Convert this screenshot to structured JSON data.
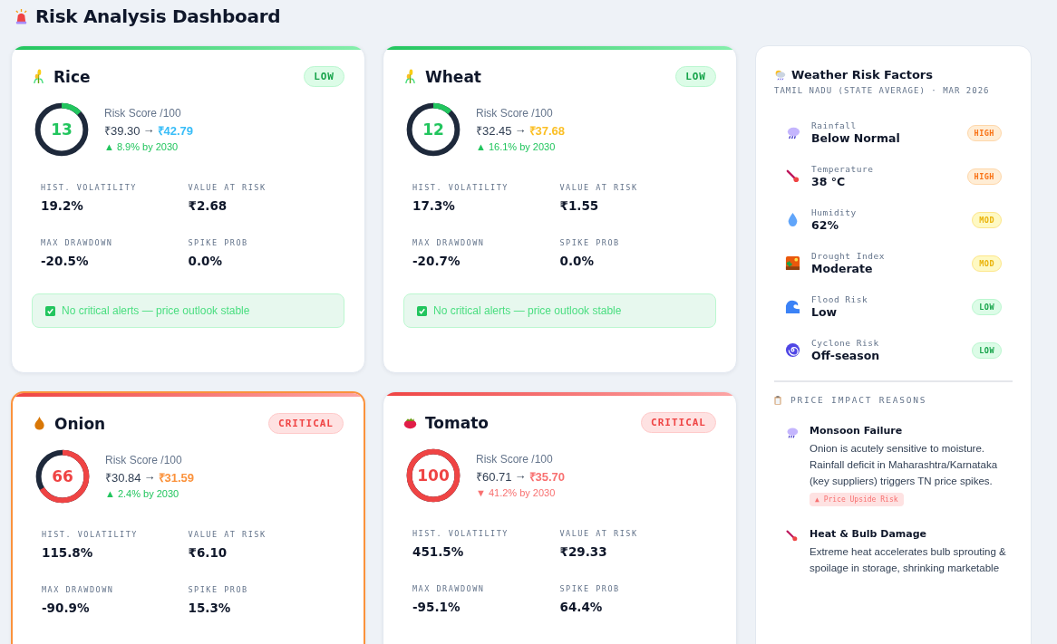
{
  "title": "Risk Analysis Dashboard",
  "crops": [
    {
      "name": "Rice",
      "kind": "low",
      "badge": "LOW",
      "selected": false,
      "level": 0.13,
      "score": "13",
      "score_label": "Risk Score /100",
      "price_now": "₹39.30",
      "arrow": "→",
      "price_future": "₹42.79",
      "color": "#38bdf8",
      "change": {
        "kind": "up",
        "text": "▲ 8.9% by 2030"
      },
      "metrics": [
        {
          "label": "HIST. VOLATILITY",
          "value": "19.2%"
        },
        {
          "label": "VALUE AT RISK",
          "value": "₹2.68"
        },
        {
          "label": "MAX DRAWDOWN",
          "value": "-20.5%"
        },
        {
          "label": "SPIKE PROB",
          "value": "0.0%"
        }
      ],
      "alert": "No critical alerts — price outlook stable"
    },
    {
      "name": "Wheat",
      "kind": "low",
      "badge": "LOW",
      "selected": false,
      "level": 0.12,
      "score": "12",
      "score_label": "Risk Score /100",
      "price_now": "₹32.45",
      "arrow": "→",
      "price_future": "₹37.68",
      "color": "#fbbf24",
      "change": {
        "kind": "up",
        "text": "▲ 16.1% by 2030"
      },
      "metrics": [
        {
          "label": "HIST. VOLATILITY",
          "value": "17.3%"
        },
        {
          "label": "VALUE AT RISK",
          "value": "₹1.55"
        },
        {
          "label": "MAX DRAWDOWN",
          "value": "-20.7%"
        },
        {
          "label": "SPIKE PROB",
          "value": "0.0%"
        }
      ],
      "alert": "No critical alerts — price outlook stable"
    },
    {
      "name": "Onion",
      "kind": "critical",
      "badge": "CRITICAL",
      "selected": true,
      "level": 0.66,
      "score": "66",
      "score_label": "Risk Score /100",
      "price_now": "₹30.84",
      "arrow": "→",
      "price_future": "₹31.59",
      "color": "#fb923c",
      "change": {
        "kind": "up",
        "text": "▲ 2.4% by 2030"
      },
      "metrics": [
        {
          "label": "HIST. VOLATILITY",
          "value": "115.8%"
        },
        {
          "label": "VALUE AT RISK",
          "value": "₹6.10"
        },
        {
          "label": "MAX DRAWDOWN",
          "value": "-90.9%"
        },
        {
          "label": "SPIKE PROB",
          "value": "15.3%"
        }
      ]
    },
    {
      "name": "Tomato",
      "kind": "critical",
      "badge": "CRITICAL",
      "selected": false,
      "level": 1,
      "score": "100",
      "score_label": "Risk Score /100",
      "price_now": "₹60.71",
      "arrow": "→",
      "price_future": "₹35.70",
      "color": "#f87171",
      "change": {
        "kind": "down",
        "text": "▼ 41.2% by 2030"
      },
      "metrics": [
        {
          "label": "HIST. VOLATILITY",
          "value": "451.5%"
        },
        {
          "label": "VALUE AT RISK",
          "value": "₹29.33"
        },
        {
          "label": "MAX DRAWDOWN",
          "value": "-95.1%"
        },
        {
          "label": "SPIKE PROB",
          "value": "64.4%"
        }
      ]
    }
  ],
  "weather": {
    "title": "Weather Risk Factors",
    "subtitle": "TAMIL NADU (STATE AVERAGE) · MAR 2026",
    "factors": [
      {
        "label": "Rainfall",
        "value": "Below Normal",
        "kind": "high",
        "badge": "HIGH"
      },
      {
        "label": "Temperature",
        "value": "38 °C",
        "kind": "high",
        "badge": "HIGH"
      },
      {
        "label": "Humidity",
        "value": "62%",
        "kind": "mod",
        "badge": "MOD"
      },
      {
        "label": "Drought Index",
        "value": "Moderate",
        "kind": "mod",
        "badge": "MOD"
      },
      {
        "label": "Flood Risk",
        "value": "Low",
        "kind": "low",
        "badge": "LOW"
      },
      {
        "label": "Cyclone Risk",
        "value": "Off-season",
        "kind": "low",
        "badge": "LOW"
      }
    ],
    "reasons_title": "PRICE IMPACT REASONS",
    "reasons": [
      {
        "title": "Monsoon Failure",
        "text": "Onion is acutely sensitive to moisture. Rainfall deficit in Maharashtra/Karnataka (key suppliers) triggers TN price spikes.",
        "tag": "▲ Price Upside Risk"
      },
      {
        "title": "Heat & Bulb Damage",
        "text": "Extreme heat accelerates bulb sprouting & spoilage in storage, shrinking marketable"
      }
    ]
  }
}
